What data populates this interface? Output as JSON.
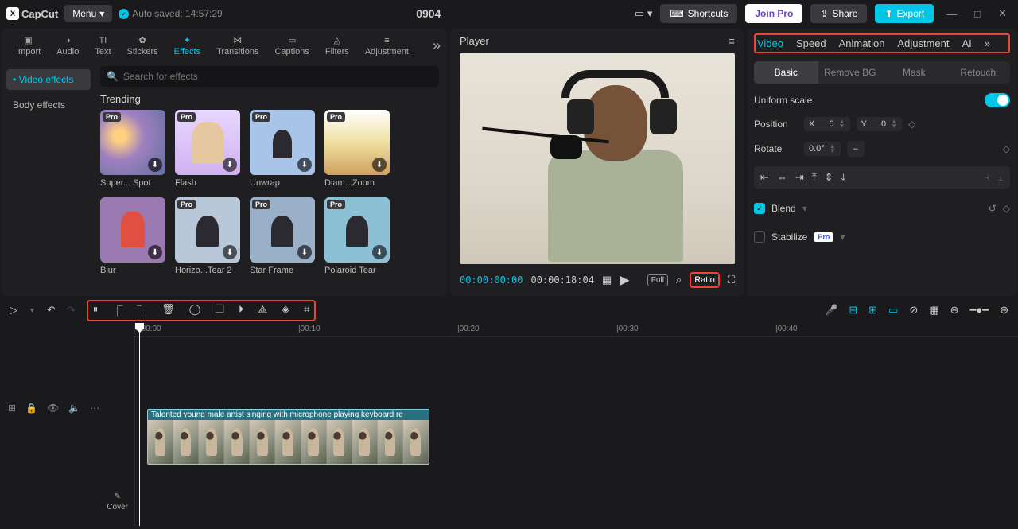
{
  "titlebar": {
    "app": "CapCut",
    "menu": "Menu",
    "autosave_text": "Auto saved: 14:57:29",
    "project": "0904",
    "shortcuts": "Shortcuts",
    "joinpro": "Join Pro",
    "share": "Share",
    "export": "Export"
  },
  "tool_tabs": [
    "Import",
    "Audio",
    "Text",
    "Stickers",
    "Effects",
    "Transitions",
    "Captions",
    "Filters",
    "Adjustment"
  ],
  "tool_active": "Effects",
  "sub_tabs": {
    "video": "Video effects",
    "body": "Body effects"
  },
  "search": {
    "placeholder": "Search for effects"
  },
  "section": "Trending",
  "effects": [
    {
      "name": "Super... Spot",
      "pro": true
    },
    {
      "name": "Flash",
      "pro": true
    },
    {
      "name": "Unwrap",
      "pro": true
    },
    {
      "name": "Diam...Zoom",
      "pro": true
    },
    {
      "name": "Blur",
      "pro": false
    },
    {
      "name": "Horizo...Tear 2",
      "pro": true
    },
    {
      "name": "Star Frame",
      "pro": true
    },
    {
      "name": "Polaroid Tear",
      "pro": true
    }
  ],
  "player": {
    "title": "Player",
    "current": "00:00:00:00",
    "duration": "00:00:18:04",
    "full": "Full",
    "ratio": "Ratio"
  },
  "inspector": {
    "tabs": [
      "Video",
      "Speed",
      "Animation",
      "Adjustment",
      "AI"
    ],
    "tab_overflow": "»",
    "subtabs": [
      "Basic",
      "Remove BG",
      "Mask",
      "Retouch"
    ],
    "uniform": "Uniform scale",
    "position": "Position",
    "x": "X",
    "y": "Y",
    "xval": "0",
    "yval": "0",
    "rotate": "Rotate",
    "rotval": "0.0°",
    "blend": "Blend",
    "stabilize": "Stabilize",
    "pro": "Pro"
  },
  "ruler": [
    "00:00",
    "00:10",
    "00:20",
    "00:30",
    "00:40"
  ],
  "clip": {
    "label": "Talented young male artist singing with microphone playing keyboard re"
  },
  "cover": "Cover"
}
